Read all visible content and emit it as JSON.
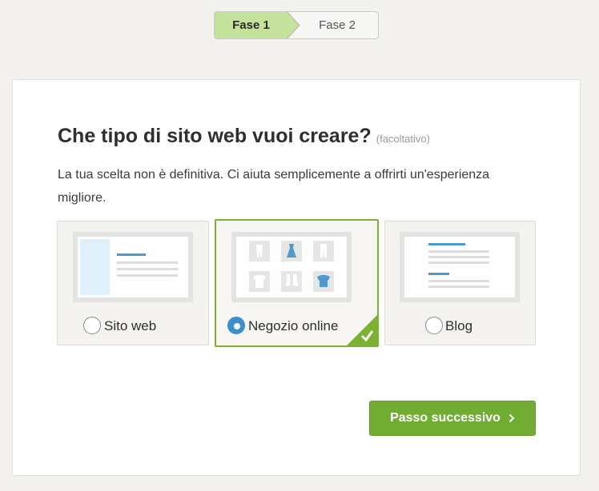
{
  "stepper": {
    "step1_label": "Fase 1",
    "step2_label": "Fase 2",
    "active_step": 1,
    "active_color": "#c4e29a"
  },
  "card": {
    "title": "Che tipo di sito web vuoi creare?",
    "optional": "(facoltativo)",
    "description": "La tua scelta non è definitiva. Ci aiuta semplicemente a offrirti un'esperienza migliore."
  },
  "options": [
    {
      "label": "Sito web",
      "icon": "website-layout-icon",
      "selected": false
    },
    {
      "label": "Negozio online",
      "icon": "online-shop-layout-icon",
      "selected": true
    },
    {
      "label": "Blog",
      "icon": "blog-layout-icon",
      "selected": false
    }
  ],
  "next_button": {
    "label": "Passo successivo",
    "icon": "chevron-right-icon",
    "color": "#72ad33"
  },
  "colors": {
    "accent_blue": "#3a8fd0",
    "selected_border": "#7ab231"
  }
}
